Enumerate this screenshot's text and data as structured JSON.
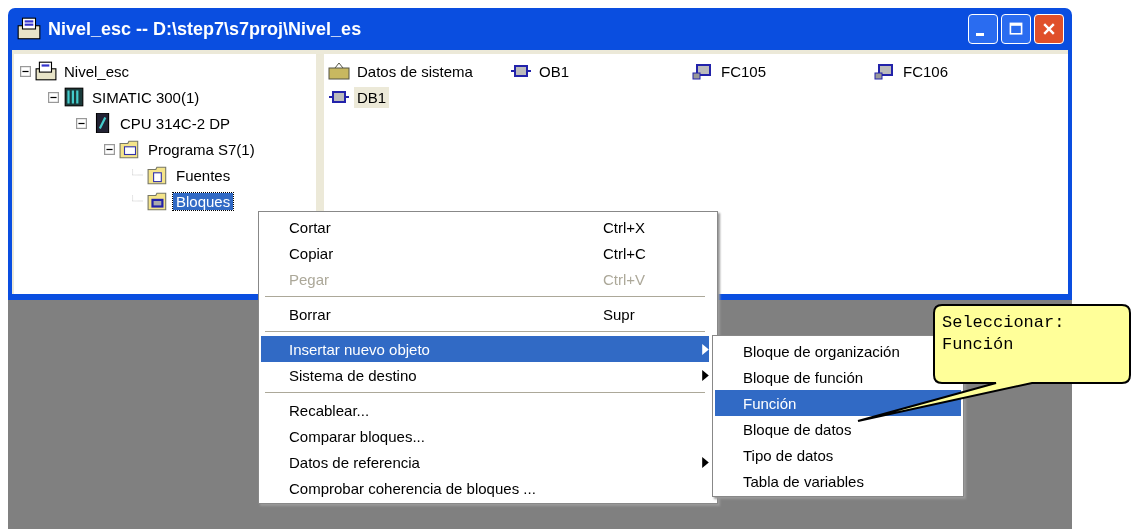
{
  "window": {
    "title": "Nivel_esc -- D:\\step7\\s7proj\\Nivel_es"
  },
  "tree": [
    {
      "label": "Nivel_esc",
      "kind": "project",
      "expanded": true,
      "selected": false,
      "children": [
        {
          "label": "SIMATIC 300(1)",
          "kind": "station",
          "expanded": true,
          "selected": false,
          "children": [
            {
              "label": "CPU 314C-2 DP",
              "kind": "cpu",
              "expanded": true,
              "selected": false,
              "children": [
                {
                  "label": "Programa S7(1)",
                  "kind": "program",
                  "expanded": true,
                  "selected": false,
                  "children": [
                    {
                      "label": "Fuentes",
                      "kind": "sources",
                      "selected": false
                    },
                    {
                      "label": "Bloques",
                      "kind": "blocks",
                      "selected": true
                    }
                  ]
                }
              ]
            }
          ]
        }
      ]
    }
  ],
  "objects": [
    {
      "label": "Datos de sistema",
      "kind": "system",
      "selected": false
    },
    {
      "label": "OB1",
      "kind": "block",
      "selected": false
    },
    {
      "label": "FC105",
      "kind": "function",
      "selected": false
    },
    {
      "label": "FC106",
      "kind": "function",
      "selected": false
    },
    {
      "label": "DB1",
      "kind": "block",
      "selected": true
    }
  ],
  "context_menu": [
    {
      "kind": "item",
      "label": "Cortar",
      "shortcut": "Ctrl+X",
      "disabled": false,
      "submenu": false,
      "selected": false
    },
    {
      "kind": "item",
      "label": "Copiar",
      "shortcut": "Ctrl+C",
      "disabled": false,
      "submenu": false,
      "selected": false
    },
    {
      "kind": "item",
      "label": "Pegar",
      "shortcut": "Ctrl+V",
      "disabled": true,
      "submenu": false,
      "selected": false
    },
    {
      "kind": "separator"
    },
    {
      "kind": "item",
      "label": "Borrar",
      "shortcut": "Supr",
      "disabled": false,
      "submenu": false,
      "selected": false
    },
    {
      "kind": "separator"
    },
    {
      "kind": "item",
      "label": "Insertar nuevo objeto",
      "disabled": false,
      "submenu": true,
      "selected": true
    },
    {
      "kind": "item",
      "label": "Sistema de destino",
      "disabled": false,
      "submenu": true,
      "selected": false
    },
    {
      "kind": "separator"
    },
    {
      "kind": "item",
      "label": "Recablear...",
      "disabled": false,
      "submenu": false,
      "selected": false
    },
    {
      "kind": "item",
      "label": "Comparar bloques...",
      "disabled": false,
      "submenu": false,
      "selected": false
    },
    {
      "kind": "item",
      "label": "Datos de referencia",
      "disabled": false,
      "submenu": true,
      "selected": false
    },
    {
      "kind": "item",
      "label": "Comprobar coherencia de bloques ...",
      "disabled": false,
      "submenu": false,
      "selected": false
    }
  ],
  "submenu": [
    {
      "label": "Bloque de organización",
      "selected": false
    },
    {
      "label": "Bloque de función",
      "selected": false
    },
    {
      "label": "Función",
      "selected": true
    },
    {
      "label": "Bloque de datos",
      "selected": false
    },
    {
      "label": "Tipo de datos",
      "selected": false
    },
    {
      "label": "Tabla de variables",
      "selected": false
    }
  ],
  "callout": {
    "lines": [
      "Seleccionar:",
      "Función"
    ]
  }
}
